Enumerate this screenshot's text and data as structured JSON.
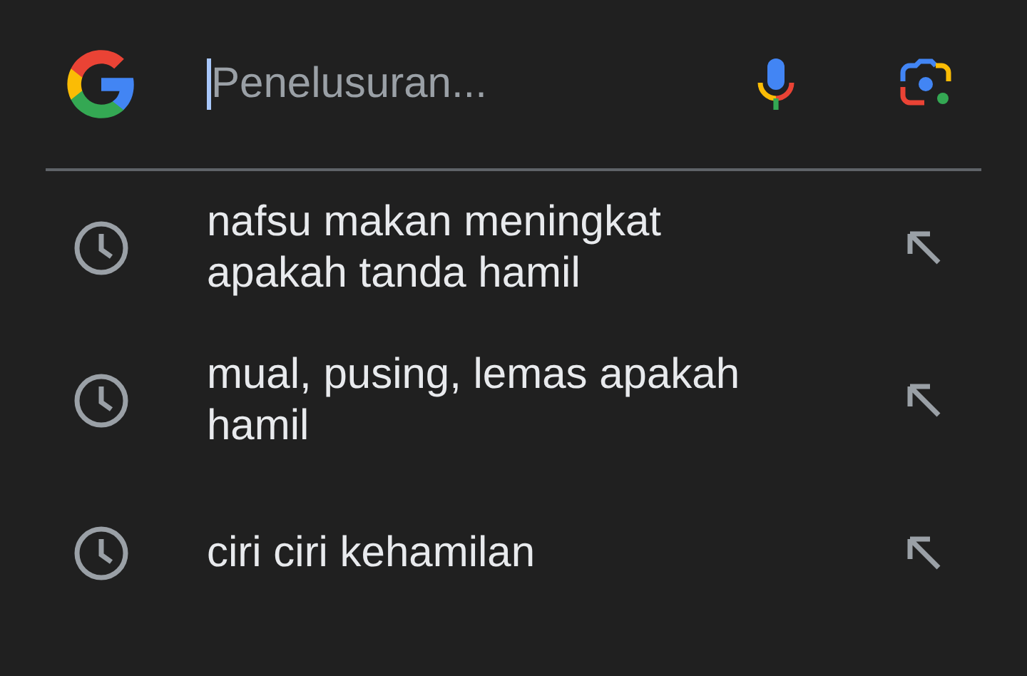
{
  "search": {
    "placeholder": "Penelusuran..."
  },
  "suggestions": [
    {
      "text": "nafsu makan meningkat apakah tanda hamil"
    },
    {
      "text": "mual, pusing, lemas apakah hamil"
    },
    {
      "text": "ciri ciri kehamilan"
    }
  ]
}
